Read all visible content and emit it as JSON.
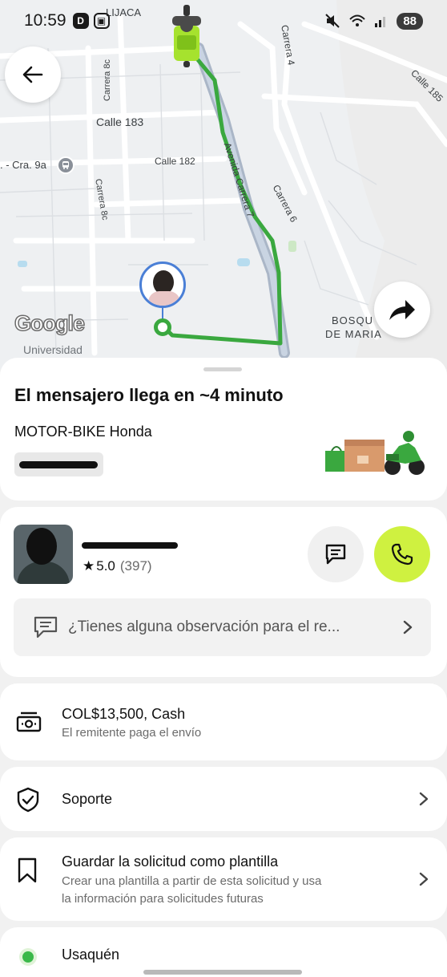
{
  "status_bar": {
    "time": "10:59",
    "battery": "88",
    "left_icons": [
      "D",
      "▣"
    ]
  },
  "map": {
    "labels": {
      "lijaca": "LIJACA",
      "calle_183": "Calle 183",
      "calle_182": "Calle 182",
      "cra_9a": ". - Cra. 9a",
      "carrera_8c_top": "Carrera 8c",
      "carrera_8c_mid": "Carrera 8c",
      "carrera_4": "Carrera 4",
      "carrera_6": "Carrera 6",
      "avenida_carrera_7": "Avenida Carrera 7",
      "calle_185": "Calle 185",
      "bosque_de_maria_1": "BOSQU",
      "bosque_de_maria_2": "DE MARIA",
      "universidad": "Universidad",
      "google": "Google"
    },
    "route_color": "#3aa83f"
  },
  "trip": {
    "eta_title": "El mensajero llega en ~4 minuto",
    "vehicle": "MOTOR-BIKE Honda"
  },
  "courier": {
    "rating": "5.0",
    "rating_count": "(397)",
    "note_placeholder": "¿Tienes alguna observación para el re..."
  },
  "payment": {
    "amount": "COL$13,500, Cash",
    "subtitle": "El remitente paga el envío"
  },
  "support": {
    "label": "Soporte"
  },
  "template": {
    "title": "Guardar la solicitud como plantilla",
    "subtitle_line1": "Crear una plantilla a partir de esta solicitud y usa",
    "subtitle_line2": "la información para solicitudes futuras"
  },
  "origin": {
    "label": "Usaquén"
  },
  "colors": {
    "accent_lime": "#cff140",
    "route_green": "#3aa83f"
  }
}
